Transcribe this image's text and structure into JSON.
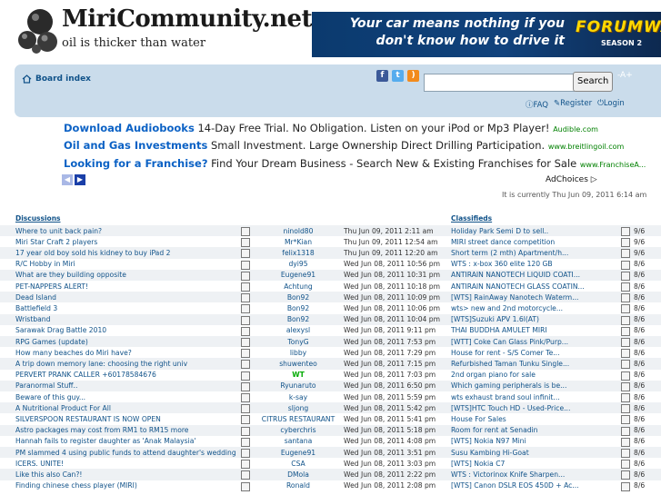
{
  "header": {
    "site_title": "MiriCommunity.net",
    "tagline": "oil is thicker than water"
  },
  "banner": {
    "line1": "Your car means nothing if you",
    "line2": "don't know how to drive it",
    "logo": "FORUMWARS",
    "sub": "SEASON 2"
  },
  "nav": {
    "board_index": "Board index",
    "search_button": "Search",
    "search_placeholder": "",
    "font_size": "-A+",
    "faq": "FAQ",
    "register": "Register",
    "login": "Login"
  },
  "ads": [
    {
      "title": "Download Audiobooks",
      "text": " 14-Day Free Trial. No Obligation. Listen on your iPod or Mp3 Player! ",
      "url": "Audible.com"
    },
    {
      "title": "Oil and Gas Investments",
      "text": " Small Investment. Large Ownership Direct Drilling Participation. ",
      "url": "www.breitlingoil.com"
    },
    {
      "title": "Looking for a Franchise?",
      "text": " Find Your Dream Business - Search New & Existing Franchises for Sale ",
      "url": "www.FranchiseA..."
    }
  ],
  "adchoices": "AdChoices",
  "current_time": "It is currently Thu Jun 09, 2011 6:14 am",
  "headers": {
    "discussions": "Discussions",
    "classifieds": "Classifieds"
  },
  "discussions": [
    {
      "title": "Where to unit back pain?",
      "user": "ninold80",
      "time": "Thu Jun 09, 2011 2:11 am"
    },
    {
      "title": "Miri Star Craft 2 players",
      "user": "Mr*Kian",
      "time": "Thu Jun 09, 2011 12:54 am"
    },
    {
      "title": "17 year old boy sold his kidney to buy iPad 2",
      "user": "felix1318",
      "time": "Thu Jun 09, 2011 12:20 am"
    },
    {
      "title": "R/C Hobby in Miri",
      "user": "dyi95",
      "time": "Wed Jun 08, 2011 10:56 pm"
    },
    {
      "title": "What are they building opposite",
      "user": "Eugene91",
      "time": "Wed Jun 08, 2011 10:31 pm"
    },
    {
      "title": "PET-NAPPERS ALERT!",
      "user": "Achtung",
      "time": "Wed Jun 08, 2011 10:18 pm"
    },
    {
      "title": "Dead Island",
      "user": "Bon92",
      "time": "Wed Jun 08, 2011 10:09 pm"
    },
    {
      "title": "Battlefield 3",
      "user": "Bon92",
      "time": "Wed Jun 08, 2011 10:06 pm"
    },
    {
      "title": "Wristband",
      "user": "Bon92",
      "time": "Wed Jun 08, 2011 10:04 pm"
    },
    {
      "title": "Sarawak Drag Battle 2010",
      "user": "alexysl",
      "time": "Wed Jun 08, 2011 9:11 pm"
    },
    {
      "title": "RPG Games (update)",
      "user": "TonyG",
      "time": "Wed Jun 08, 2011 7:53 pm"
    },
    {
      "title": "How many beaches do Miri have?",
      "user": "libby",
      "time": "Wed Jun 08, 2011 7:29 pm"
    },
    {
      "title": "A trip down memory lane: choosing the right univ",
      "user": "shuwenteo",
      "time": "Wed Jun 08, 2011 7:15 pm"
    },
    {
      "title": "PERVERT PRANK CALLER +60178584676",
      "user": "WT",
      "time": "Wed Jun 08, 2011 7:03 pm"
    },
    {
      "title": "Paranormal Stuff..",
      "user": "Ryunaruto",
      "time": "Wed Jun 08, 2011 6:50 pm"
    },
    {
      "title": "Beware of this guy...",
      "user": "k-say",
      "time": "Wed Jun 08, 2011 5:59 pm"
    },
    {
      "title": "A Nutritional Product For All",
      "user": "sljong",
      "time": "Wed Jun 08, 2011 5:42 pm"
    },
    {
      "title": "SILVERSPOON RESTAURANT IS NOW OPEN",
      "user": "CITRUS RESTAURANT",
      "time": "Wed Jun 08, 2011 5:41 pm"
    },
    {
      "title": "Astro packages may cost from RM1 to RM15 more",
      "user": "cyberchris",
      "time": "Wed Jun 08, 2011 5:18 pm"
    },
    {
      "title": "Hannah fails to register daughter as 'Anak Malaysia'",
      "user": "santana",
      "time": "Wed Jun 08, 2011 4:08 pm"
    },
    {
      "title": "PM slammed 4 using public funds to attend daughter's wedding",
      "user": "Eugene91",
      "time": "Wed Jun 08, 2011 3:51 pm"
    },
    {
      "title": "ICERS. UNITE!",
      "user": "CSA",
      "time": "Wed Jun 08, 2011 3:03 pm"
    },
    {
      "title": "Like this also Can?!",
      "user": "DMola",
      "time": "Wed Jun 08, 2011 2:22 pm"
    },
    {
      "title": "Finding chinese chess player (MIRI)",
      "user": "Ronald",
      "time": "Wed Jun 08, 2011 2:08 pm"
    }
  ],
  "classifieds": [
    {
      "title": "Holiday Park Semi D to sell..",
      "date": "9/6"
    },
    {
      "title": "MIRI street dance competition",
      "date": "9/6"
    },
    {
      "title": "Short term (2 mth) Apartment/h...",
      "date": "9/6"
    },
    {
      "title": "WTS : x-box 360 elite 120 GB",
      "date": "8/6"
    },
    {
      "title": "ANTIRAIN NANOTECH LIQUID COATI...",
      "date": "8/6"
    },
    {
      "title": "ANTIRAIN NANOTECH GLASS COATIN...",
      "date": "8/6"
    },
    {
      "title": "[WTS] RainAway Nanotech Waterm...",
      "date": "8/6"
    },
    {
      "title": "wts> new and 2nd motorcycle...",
      "date": "8/6"
    },
    {
      "title": "[WTS]Suzuki APV 1.6l(AT)",
      "date": "8/6"
    },
    {
      "title": "THAI BUDDHA AMULET MIRI",
      "date": "8/6"
    },
    {
      "title": "[WTT] Coke Can Glass Pink/Purp...",
      "date": "8/6"
    },
    {
      "title": "House for rent - S/S Comer Te...",
      "date": "8/6"
    },
    {
      "title": "Refurbished Taman Tunku Single...",
      "date": "8/6"
    },
    {
      "title": "2nd organ piano for sale",
      "date": "8/6"
    },
    {
      "title": "Which gaming peripherals is be...",
      "date": "8/6"
    },
    {
      "title": "wts exhaust brand soul infinit...",
      "date": "8/6"
    },
    {
      "title": "[WTS]HTC Touch HD - Used-Price...",
      "date": "8/6"
    },
    {
      "title": "House For Sales",
      "date": "8/6"
    },
    {
      "title": "Room for rent at Senadin",
      "date": "8/6"
    },
    {
      "title": "[WTS] Nokia N97 Mini",
      "date": "8/6"
    },
    {
      "title": "Susu Kambing Hi-Goat",
      "date": "8/6"
    },
    {
      "title": "[WTS] Nokia C7",
      "date": "8/6"
    },
    {
      "title": "WTS : Victorinox Knife Sharpen...",
      "date": "8/6"
    },
    {
      "title": "[WTS] Canon DSLR EOS 450D + Ac...",
      "date": "8/6"
    }
  ],
  "colors": {
    "link": "#105289",
    "nav_bg": "#cadceb",
    "ad_title": "#0c62c5",
    "ad_url": "#008000",
    "highlight_user": "#00aa00"
  }
}
